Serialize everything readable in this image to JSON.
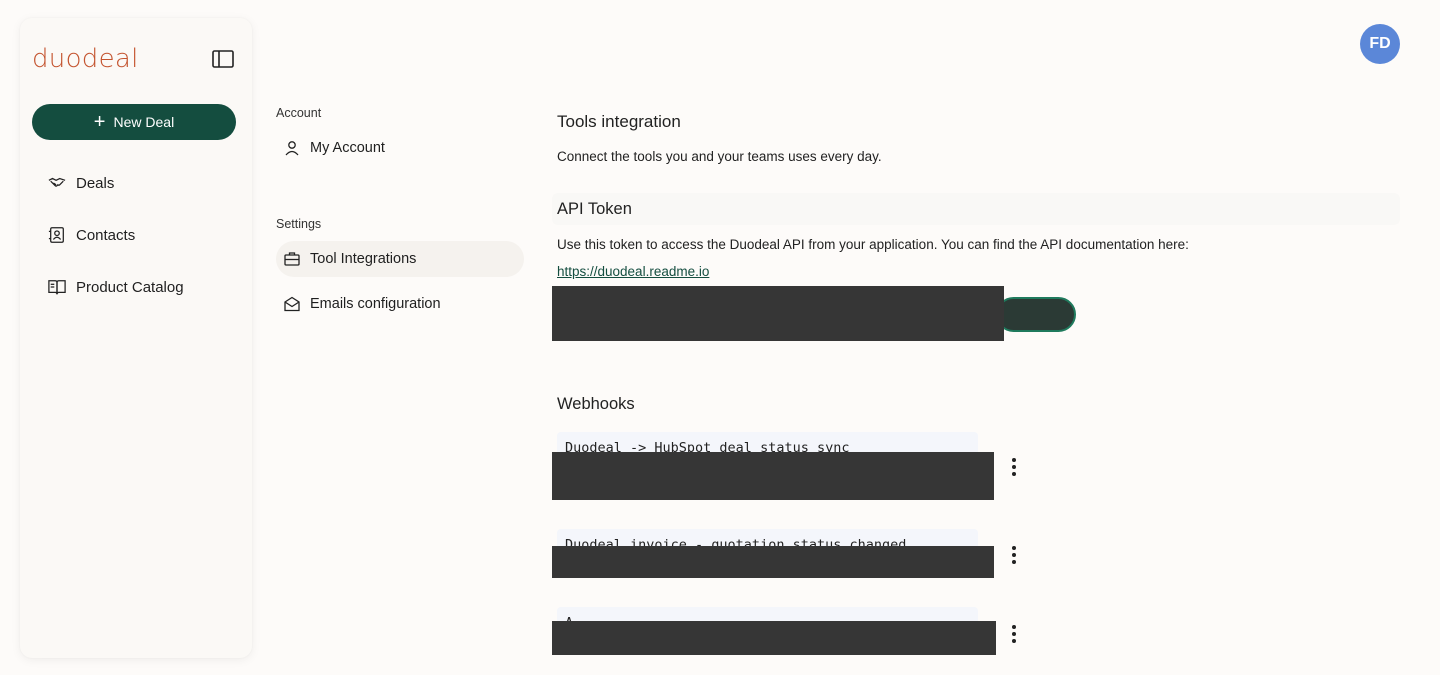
{
  "app": {
    "logo_text": "duodeal"
  },
  "user": {
    "initials": "FD",
    "avatar_color": "#5b87d8"
  },
  "sidebar": {
    "new_deal_label": "New Deal",
    "items": [
      {
        "label": "Deals",
        "icon": "handshake-icon"
      },
      {
        "label": "Contacts",
        "icon": "contact-card-icon"
      },
      {
        "label": "Product Catalog",
        "icon": "book-icon"
      }
    ]
  },
  "settings_nav": {
    "account_section": "Account",
    "account_items": [
      {
        "label": "My Account",
        "icon": "user-icon"
      }
    ],
    "settings_section": "Settings",
    "settings_items": [
      {
        "label": "Tool Integrations",
        "icon": "briefcase-icon",
        "active": true
      },
      {
        "label": "Emails configuration",
        "icon": "envelope-open-icon",
        "active": false
      }
    ]
  },
  "main": {
    "title": "Tools integration",
    "description": "Connect the tools you and your teams uses every day.",
    "api": {
      "title": "API Token",
      "description": "Use this token to access the Duodeal API from your application. You can find the API documentation here:",
      "link": "https://duodeal.readme.io"
    },
    "webhooks": {
      "title": "Webhooks",
      "items": [
        {
          "name": "Duodeal -> HubSpot deal status sync"
        },
        {
          "name": "Duodeal invoice - quotation status changed"
        },
        {
          "name": "A"
        }
      ]
    }
  },
  "colors": {
    "brand": "#c4542f",
    "primary": "#144d3f",
    "redaction": "#363636"
  }
}
